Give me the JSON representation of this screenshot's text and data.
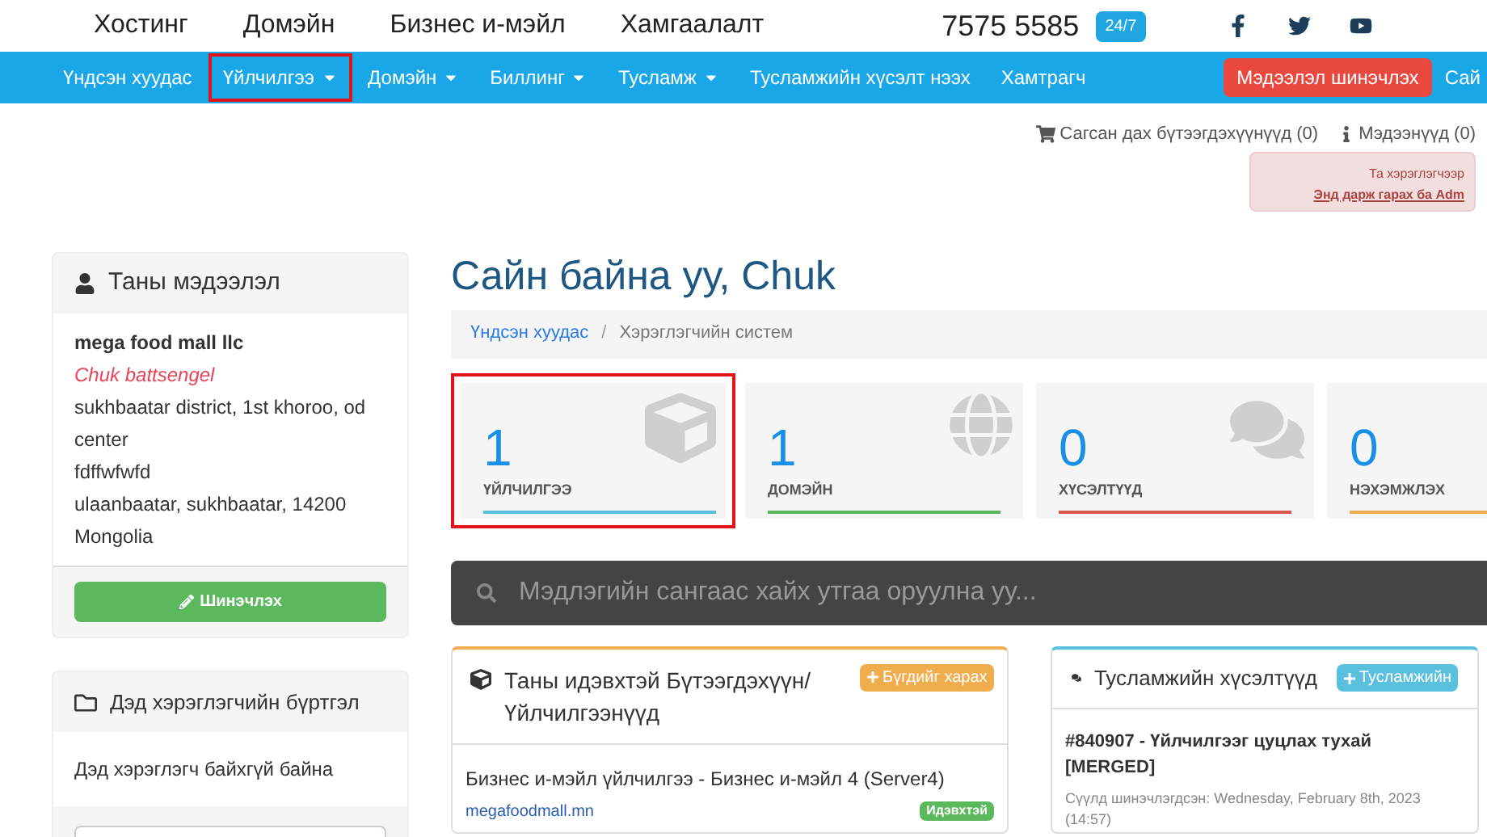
{
  "header": {
    "links": [
      "Хостинг",
      "Домэйн",
      "Бизнес и-мэйл",
      "Хамгаалалт"
    ],
    "phone": "7575 5585",
    "badge": "24/7"
  },
  "nav": {
    "items": [
      {
        "label": "Үндсэн хуудас",
        "dropdown": false,
        "highlighted": false
      },
      {
        "label": "Үйлчилгээ",
        "dropdown": true,
        "highlighted": true
      },
      {
        "label": "Домэйн",
        "dropdown": true,
        "highlighted": false
      },
      {
        "label": "Биллинг",
        "dropdown": true,
        "highlighted": false
      },
      {
        "label": "Тусламж",
        "dropdown": true,
        "highlighted": false
      },
      {
        "label": "Тусламжийн хүсэлт нээх",
        "dropdown": false,
        "highlighted": false
      },
      {
        "label": "Хамтрагч",
        "dropdown": false,
        "highlighted": false
      }
    ],
    "update_button": "Мэдээлэл шинэчлэх",
    "right_item": "Сай"
  },
  "top_links": [
    {
      "kind": "cart",
      "label": "Сагсан дах бүтээгдэхүүнүүд (0)"
    },
    {
      "kind": "info",
      "label": "Мэдээнүүд (0)"
    }
  ],
  "alert": {
    "text": "Та хэрэглэгчээр",
    "link": "Энд дарж гарах ба Adm"
  },
  "profile_panel": {
    "title": "Таны мэдээлэл",
    "company": "mega food mall llc",
    "name": "Chuk battsengel",
    "address_lines": [
      "sukhbaatar district, 1st khoroo, od center",
      "fdffwfwfd",
      "ulaanbaatar, sukhbaatar, 14200",
      "Mongolia"
    ],
    "button": "Шинэчлэх"
  },
  "subaccount_panel": {
    "title": "Дэд хэрэглэгчийн бүртгэл",
    "text": "Дэд хэрэглэгч байхгүй байна"
  },
  "greeting": "Сайн байна уу, Chuk",
  "breadcrumb_separator": "/",
  "breadcrumb": [
    {
      "label": "Үндсэн хуудас",
      "selected": false
    },
    {
      "label": "Хэрэглэгчийн систем",
      "selected": true
    }
  ],
  "stats": [
    {
      "kind": "box",
      "value": "1",
      "label": "ҮЙЛЧИЛГЭЭ",
      "color": "#5bc0de",
      "highlighted": true
    },
    {
      "kind": "globe",
      "value": "1",
      "label": "ДОМЭЙН",
      "color": "#5cb85c",
      "highlighted": false
    },
    {
      "kind": "chat",
      "value": "0",
      "label": "ХҮСЭЛТҮҮД",
      "color": "#d9534f",
      "highlighted": false
    },
    {
      "kind": "invoice",
      "value": "0",
      "label": "НЭХЭМЖЛЭХ",
      "color": "#f0ad4e",
      "highlighted": false
    }
  ],
  "search": {
    "placeholder": "Мэдлэгийн сангаас хайх утгаа оруулна уу..."
  },
  "products_panel": {
    "title": "Таны идэвхтэй Бүтээгдэхүүн/ Үйлчилгээнүүд",
    "button": "Бүгдийг харах",
    "items": [
      {
        "name": "Бизнес и-мэйл үйлчилгээ - Бизнес и-мэйл 4 (Server4)",
        "domain": "megafoodmall.mn",
        "status": "Идэвхтэй"
      }
    ]
  },
  "tickets_panel": {
    "title": "Тусламжийн хүсэлтүүд",
    "button": "Тусламжийн",
    "items": [
      {
        "title": "#840907 - Үйлчилгээг цуцлах тухай [MERGED]",
        "updated": "Сүүлд шинэчлэгдсэн: Wednesday, February 8th, 2023 (14:57)"
      }
    ]
  }
}
